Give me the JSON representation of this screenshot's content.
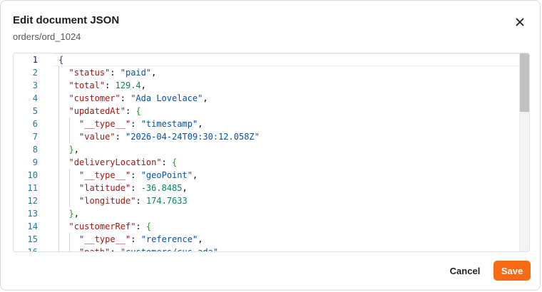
{
  "dialog": {
    "title": "Edit document JSON",
    "subtitle": "orders/ord_1024",
    "close_icon": "close-icon"
  },
  "editor": {
    "active_line": 1,
    "lines": [
      [
        [
          "{",
          "b1"
        ]
      ],
      [
        [
          "\"status\"",
          "key"
        ],
        [
          ": ",
          "p"
        ],
        [
          "\"paid\"",
          "str"
        ],
        [
          ",",
          "p"
        ]
      ],
      [
        [
          "\"total\"",
          "key"
        ],
        [
          ": ",
          "p"
        ],
        [
          "129.4",
          "num"
        ],
        [
          ",",
          "p"
        ]
      ],
      [
        [
          "\"customer\"",
          "key"
        ],
        [
          ": ",
          "p"
        ],
        [
          "\"Ada Lovelace\"",
          "str"
        ],
        [
          ",",
          "p"
        ]
      ],
      [
        [
          "\"updatedAt\"",
          "key"
        ],
        [
          ": ",
          "p"
        ],
        [
          "{",
          "b2"
        ]
      ],
      [
        [
          "\"__type__\"",
          "key"
        ],
        [
          ": ",
          "p"
        ],
        [
          "\"timestamp\"",
          "str"
        ],
        [
          ",",
          "p"
        ]
      ],
      [
        [
          "\"value\"",
          "key"
        ],
        [
          ": ",
          "p"
        ],
        [
          "\"2026-04-24T09:30:12.058Z\"",
          "str"
        ]
      ],
      [
        [
          "}",
          "b2"
        ],
        [
          ",",
          "p"
        ]
      ],
      [
        [
          "\"deliveryLocation\"",
          "key"
        ],
        [
          ": ",
          "p"
        ],
        [
          "{",
          "b2"
        ]
      ],
      [
        [
          "\"__type__\"",
          "key"
        ],
        [
          ": ",
          "p"
        ],
        [
          "\"geoPoint\"",
          "str"
        ],
        [
          ",",
          "p"
        ]
      ],
      [
        [
          "\"latitude\"",
          "key"
        ],
        [
          ": ",
          "p"
        ],
        [
          "-36.8485",
          "num"
        ],
        [
          ",",
          "p"
        ]
      ],
      [
        [
          "\"longitude\"",
          "key"
        ],
        [
          ": ",
          "p"
        ],
        [
          "174.7633",
          "num"
        ]
      ],
      [
        [
          "}",
          "b2"
        ],
        [
          ",",
          "p"
        ]
      ],
      [
        [
          "\"customerRef\"",
          "key"
        ],
        [
          ": ",
          "p"
        ],
        [
          "{",
          "b2"
        ]
      ],
      [
        [
          "\"__type__\"",
          "key"
        ],
        [
          ": ",
          "p"
        ],
        [
          "\"reference\"",
          "str"
        ],
        [
          ",",
          "p"
        ]
      ],
      [
        [
          "\"path\"",
          "key"
        ],
        [
          ": ",
          "p"
        ],
        [
          "\"customers/cus_ada\"",
          "str"
        ]
      ]
    ],
    "indent": [
      0,
      1,
      1,
      1,
      1,
      2,
      2,
      1,
      1,
      2,
      2,
      2,
      1,
      1,
      2,
      2
    ]
  },
  "footer": {
    "cancel_label": "Cancel",
    "save_label": "Save"
  },
  "colors": {
    "accent": "#f76b15",
    "json_key": "#a31515",
    "json_string": "#0451a5",
    "json_number": "#098658"
  }
}
